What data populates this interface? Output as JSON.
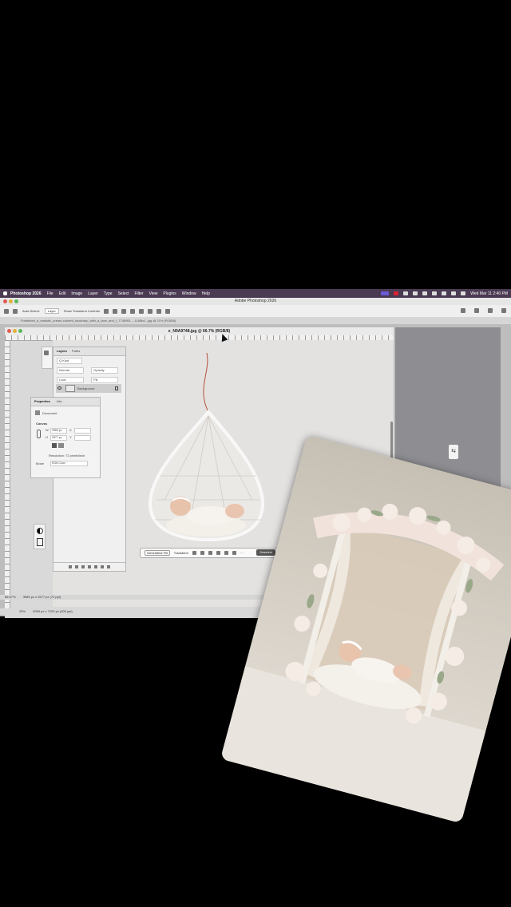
{
  "menubar": {
    "app": "Photoshop 2026",
    "items": [
      "File",
      "Edit",
      "Image",
      "Layer",
      "Type",
      "Select",
      "Filter",
      "View",
      "Plugins",
      "Window",
      "Help"
    ],
    "datetime": "Wed Mar 11  2:40 PM"
  },
  "window": {
    "title": "Adobe Photoshop 2026"
  },
  "optionsbar": {
    "auto_select": "Auto-Select:",
    "layer_select": "Layer",
    "show_transform": "Show Transform Controls"
  },
  "doc_tab": "Fotobleed_a_realistic_cream-colored_backdrop_with_a_lace_and_f_7745951...-1165bd...jpg @ 21% (RGB/8)",
  "document": {
    "title": "e_N9A9748.jpg @ 66.7% (RGB/8)",
    "zoom": "66.67%",
    "dims": "3965 px x 2577 px (72 ppi)"
  },
  "layers_panel": {
    "tabs": [
      "Layers",
      "Paths"
    ],
    "kind": "Q Kind",
    "mode": "Normal",
    "opacity": "Opacity",
    "lock": "Lock",
    "fill": "Fill",
    "layer_name": "Background"
  },
  "properties_panel": {
    "tabs": [
      "Properties",
      "Info"
    ],
    "document": "Document",
    "canvas": "Canvas",
    "w_label": "W",
    "w_value": "3965 px",
    "h_label": "H",
    "h_value": "2577 px",
    "x_label": "X",
    "y_label": "Y",
    "resolution": "Resolution: 72 pixels/inch",
    "mode_label": "Mode",
    "mode_value": "RGB Color"
  },
  "contextual_taskbar": {
    "generative_fill": "Generative Fill",
    "transform": "Transform",
    "deselect": "Deselect"
  },
  "bottom_status": {
    "zoom": "25%",
    "dims": "5990 px x 7220 px (300 ppi)"
  },
  "colors": {
    "menubar": "#4a3a52",
    "canvas": "#e3e2e0",
    "photo_bg": "#d8d2c8"
  }
}
